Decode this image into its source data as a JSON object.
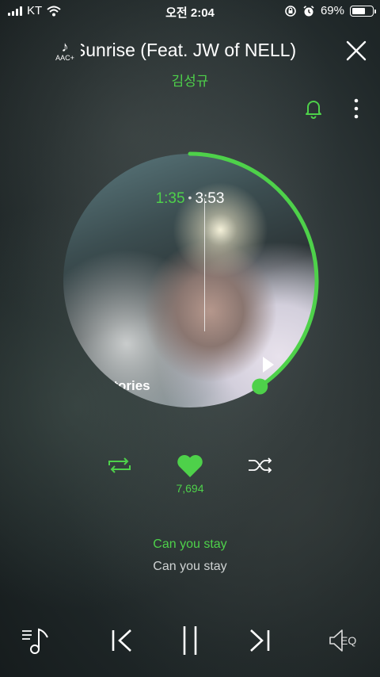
{
  "status_bar": {
    "carrier": "KT",
    "time": "오전 2:04",
    "battery_percent": "69%",
    "battery_level": 0.69,
    "icons": [
      "signal-icon",
      "wifi-icon",
      "rotation-lock-icon",
      "alarm-icon",
      "battery-icon"
    ]
  },
  "header": {
    "badge_label": "AAC+",
    "song_title": "Till Sunrise (Feat. JW of NELL)",
    "artist": "김성규",
    "icons": [
      "aac-note-icon",
      "close-icon",
      "bell-icon",
      "more-icon"
    ]
  },
  "album": {
    "caption": "Stories",
    "current_time": "1:35",
    "separator": "•",
    "total_time": "3:53",
    "progress_fraction": 0.407,
    "accent_color": "#4ed14a"
  },
  "actions": {
    "like_count": "7,694",
    "icons": [
      "repeat-icon",
      "heart-icon",
      "shuffle-icon"
    ]
  },
  "lyrics": {
    "current": "Can you stay",
    "next": "Can you stay"
  },
  "bottom_bar": {
    "eq_label": "EQ",
    "icons": [
      "playlist-icon",
      "previous-icon",
      "pause-icon",
      "next-icon",
      "speaker-eq-icon"
    ]
  }
}
